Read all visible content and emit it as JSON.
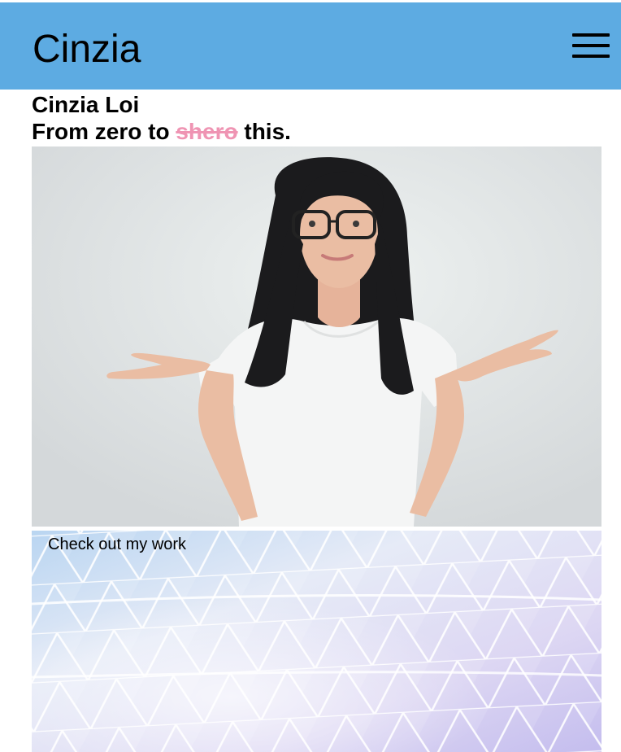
{
  "header": {
    "brand": "Cinzia",
    "background_color": "#5dabe2",
    "menu_icon": "hamburger-menu-icon"
  },
  "intro": {
    "name": "Cinzia Loi",
    "tagline_start": "From zero to",
    "tagline_struck": "shero",
    "tagline_end": "this.",
    "struck_color": "#ef94b3"
  },
  "hero": {
    "image": "portrait-photo"
  },
  "work": {
    "label": "Check out my work",
    "image": "geometric-triangle-pattern"
  }
}
